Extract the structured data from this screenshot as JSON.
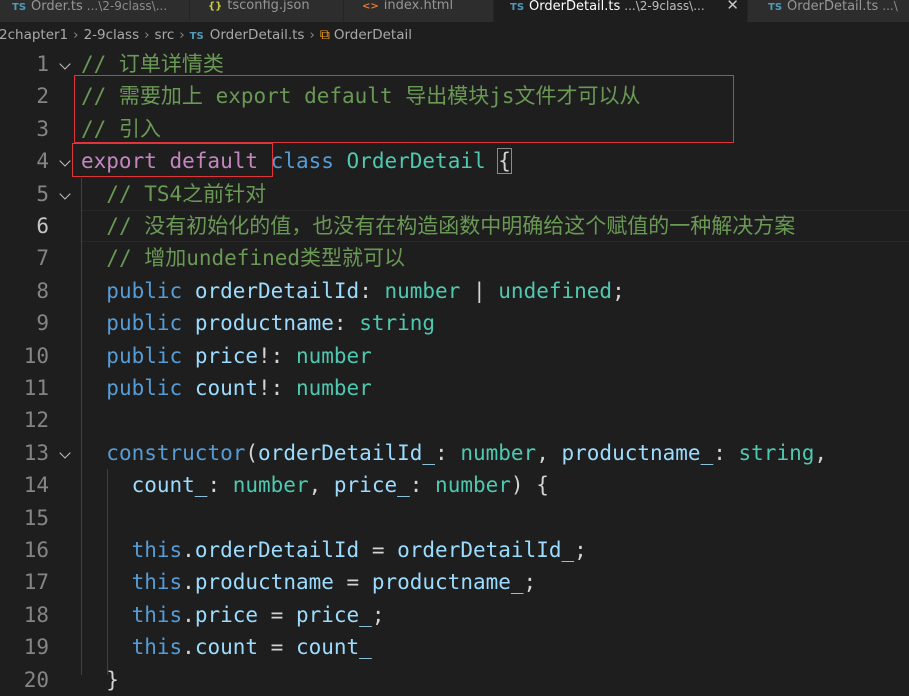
{
  "tabs": [
    {
      "name": "Order.ts",
      "desc": "...\\2-9class\\...",
      "icon": "TS",
      "active": false
    },
    {
      "name": "tsconfig.json",
      "desc": "",
      "icon": "{}",
      "active": false
    },
    {
      "name": "index.html",
      "desc": "",
      "icon": "<>",
      "active": false
    },
    {
      "name": "OrderDetail.ts",
      "desc": "...\\2-9class\\...",
      "icon": "TS",
      "active": true
    },
    {
      "name": "OrderDetail.ts",
      "desc": "...\\",
      "icon": "TS",
      "active": false
    }
  ],
  "breadcrumbs": {
    "items": [
      "2chapter1",
      "2-9class",
      "src"
    ],
    "file": "OrderDetail.ts",
    "symbol": "OrderDetail"
  },
  "editor": {
    "current_line": 6,
    "line_numbers": [
      "1",
      "2",
      "3",
      "4",
      "5",
      "6",
      "7",
      "8",
      "9",
      "10",
      "11",
      "12",
      "13",
      "14",
      "15",
      "16",
      "17",
      "18",
      "19",
      "20"
    ],
    "lines": [
      [
        [
          "cm",
          "// 订单详情类"
        ]
      ],
      [
        [
          "cm",
          "// 需要加上 export default 导出模块js文件才可以从"
        ]
      ],
      [
        [
          "cm",
          "// 引入"
        ]
      ],
      [
        [
          "ctl",
          "export default"
        ],
        [
          "pn",
          " "
        ],
        [
          "kw",
          "class"
        ],
        [
          "pn",
          " "
        ],
        [
          "cls",
          "OrderDetail"
        ],
        [
          "pn",
          " "
        ],
        [
          "brk",
          "{"
        ]
      ],
      [
        [
          "pn",
          "  "
        ],
        [
          "cm",
          "// TS4之前针对"
        ]
      ],
      [
        [
          "pn",
          "  "
        ],
        [
          "cm",
          "// 没有初始化的值，也没有在构造函数中明确给这个赋值的一种解决方案"
        ]
      ],
      [
        [
          "pn",
          "  "
        ],
        [
          "cm",
          "// 增加undefined类型就可以"
        ]
      ],
      [
        [
          "pn",
          "  "
        ],
        [
          "kw",
          "public"
        ],
        [
          "pn",
          " "
        ],
        [
          "prop",
          "orderDetailId"
        ],
        [
          "pn",
          ": "
        ],
        [
          "cls",
          "number"
        ],
        [
          "pn",
          " | "
        ],
        [
          "cls",
          "undefined"
        ],
        [
          "pn",
          ";"
        ]
      ],
      [
        [
          "pn",
          "  "
        ],
        [
          "kw",
          "public"
        ],
        [
          "pn",
          " "
        ],
        [
          "prop",
          "productname"
        ],
        [
          "pn",
          ": "
        ],
        [
          "cls",
          "string"
        ]
      ],
      [
        [
          "pn",
          "  "
        ],
        [
          "kw",
          "public"
        ],
        [
          "pn",
          " "
        ],
        [
          "prop",
          "price"
        ],
        [
          "pn",
          "!: "
        ],
        [
          "cls",
          "number"
        ]
      ],
      [
        [
          "pn",
          "  "
        ],
        [
          "kw",
          "public"
        ],
        [
          "pn",
          " "
        ],
        [
          "prop",
          "count"
        ],
        [
          "pn",
          "!: "
        ],
        [
          "cls",
          "number"
        ]
      ],
      [],
      [
        [
          "pn",
          "  "
        ],
        [
          "kw",
          "constructor"
        ],
        [
          "pn",
          "("
        ],
        [
          "prop",
          "orderDetailId_"
        ],
        [
          "pn",
          ": "
        ],
        [
          "cls",
          "number"
        ],
        [
          "pn",
          ", "
        ],
        [
          "prop",
          "productname_"
        ],
        [
          "pn",
          ": "
        ],
        [
          "cls",
          "string"
        ],
        [
          "pn",
          ","
        ]
      ],
      [
        [
          "pn",
          "    "
        ],
        [
          "prop",
          "count_"
        ],
        [
          "pn",
          ": "
        ],
        [
          "cls",
          "number"
        ],
        [
          "pn",
          ", "
        ],
        [
          "prop",
          "price_"
        ],
        [
          "pn",
          ": "
        ],
        [
          "cls",
          "number"
        ],
        [
          "pn",
          ") {"
        ]
      ],
      [],
      [
        [
          "pn",
          "    "
        ],
        [
          "kw",
          "this"
        ],
        [
          "pn",
          "."
        ],
        [
          "prop",
          "orderDetailId"
        ],
        [
          "pn",
          " = "
        ],
        [
          "prop",
          "orderDetailId_"
        ],
        [
          "pn",
          ";"
        ]
      ],
      [
        [
          "pn",
          "    "
        ],
        [
          "kw",
          "this"
        ],
        [
          "pn",
          "."
        ],
        [
          "prop",
          "productname"
        ],
        [
          "pn",
          " = "
        ],
        [
          "prop",
          "productname_"
        ],
        [
          "pn",
          ";"
        ]
      ],
      [
        [
          "pn",
          "    "
        ],
        [
          "kw",
          "this"
        ],
        [
          "pn",
          "."
        ],
        [
          "prop",
          "price"
        ],
        [
          "pn",
          " = "
        ],
        [
          "prop",
          "price_"
        ],
        [
          "pn",
          ";"
        ]
      ],
      [
        [
          "pn",
          "    "
        ],
        [
          "kw",
          "this"
        ],
        [
          "pn",
          "."
        ],
        [
          "prop",
          "count"
        ],
        [
          "pn",
          " = "
        ],
        [
          "prop",
          "count_"
        ]
      ],
      [
        [
          "pn",
          "  }"
        ]
      ]
    ]
  }
}
